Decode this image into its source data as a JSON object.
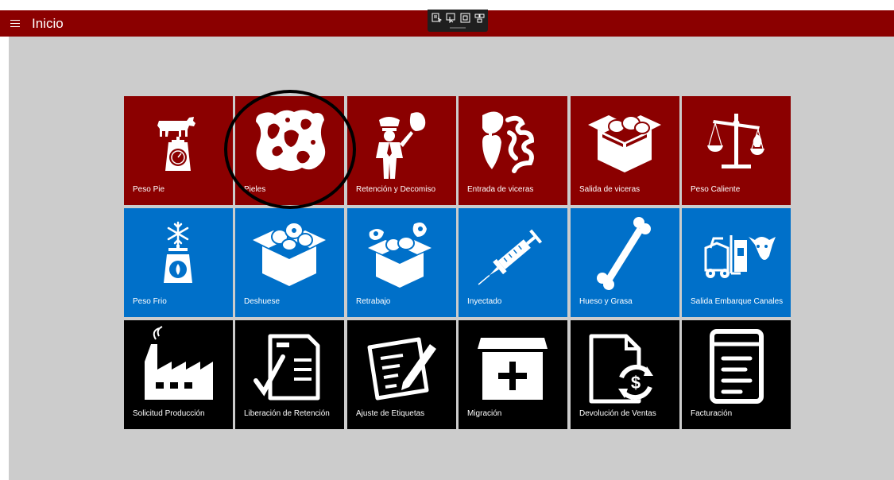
{
  "header": {
    "title": "Inicio",
    "menu_icon": "hamburger-menu-icon",
    "background": "#8b0000"
  },
  "debug_toolbar": {
    "icons": [
      "select-element-icon",
      "select-pointer-icon",
      "layout-adorner-icon",
      "track-focus-icon"
    ]
  },
  "colors": {
    "red_tile": "#8b0000",
    "blue_tile": "#0070c9",
    "black_tile": "#000000",
    "content_bg": "#cccccc"
  },
  "tiles": [
    [
      {
        "label": "Peso Pie",
        "icon": "cow-on-scale-icon"
      },
      {
        "label": "Pieles",
        "icon": "cowhide-icon"
      },
      {
        "label": "Retención y Decomiso",
        "icon": "inspector-icon"
      },
      {
        "label": "Entrada de viceras",
        "icon": "organs-icon"
      },
      {
        "label": "Salida de viceras",
        "icon": "meat-box-icon"
      },
      {
        "label": "Peso Caliente",
        "icon": "balance-fire-icon"
      }
    ],
    [
      {
        "label": "Peso Frio",
        "icon": "snowflake-scale-icon"
      },
      {
        "label": "Deshuese",
        "icon": "meat-box-icon"
      },
      {
        "label": "Retrabajo",
        "icon": "meat-box-cuts-icon"
      },
      {
        "label": "Inyectado",
        "icon": "syringe-icon"
      },
      {
        "label": "Hueso y Grasa",
        "icon": "bone-icon"
      },
      {
        "label": "Salida Embarque Canales",
        "icon": "forklift-cow-icon"
      }
    ],
    [
      {
        "label": "Solicitud Producción",
        "icon": "factory-icon"
      },
      {
        "label": "Liberación de Retención",
        "icon": "checklist-document-icon"
      },
      {
        "label": "Ajuste de Etiquetas",
        "icon": "edit-document-icon"
      },
      {
        "label": "Migración",
        "icon": "box-plus-icon"
      },
      {
        "label": "Devolución de Ventas",
        "icon": "document-refund-icon"
      },
      {
        "label": "Facturación",
        "icon": "invoice-icon"
      }
    ]
  ]
}
